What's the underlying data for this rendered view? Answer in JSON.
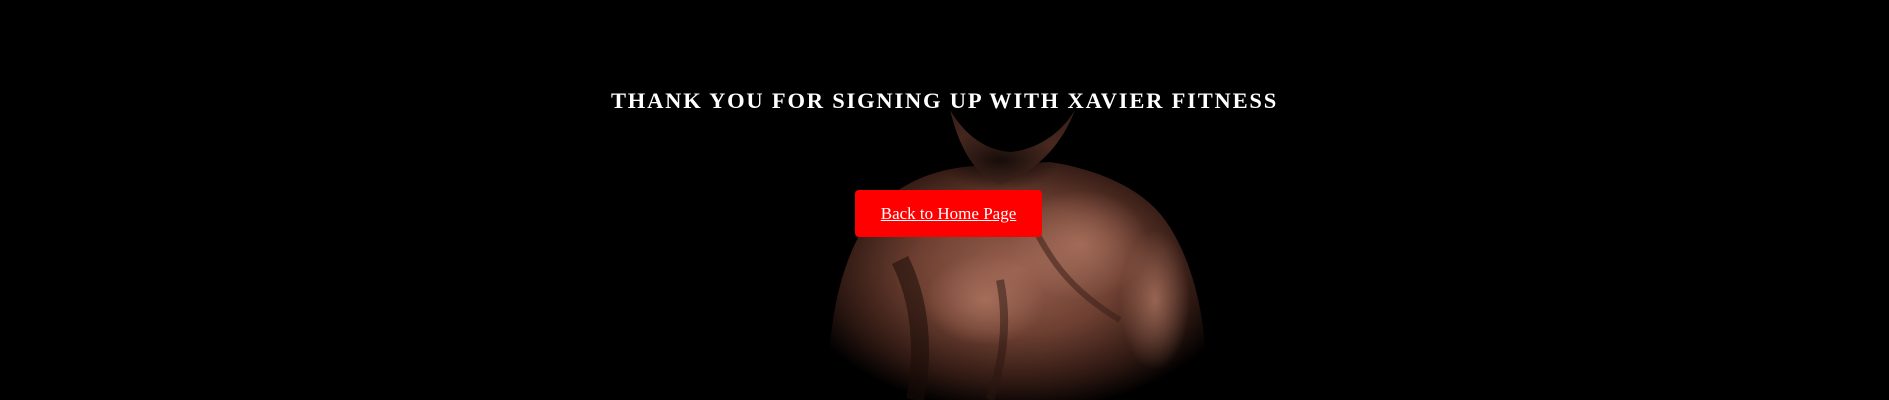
{
  "hero": {
    "background_color": "#000000",
    "image_subject": "shirtless-athlete-photo"
  },
  "headline": {
    "text": "THANK YOU FOR SIGNING UP WITH XAVIER FITNESS",
    "color": "#ffffff"
  },
  "cta": {
    "label": "Back to Home Page",
    "background_color": "#ff0000",
    "text_color": "#ffffff"
  }
}
